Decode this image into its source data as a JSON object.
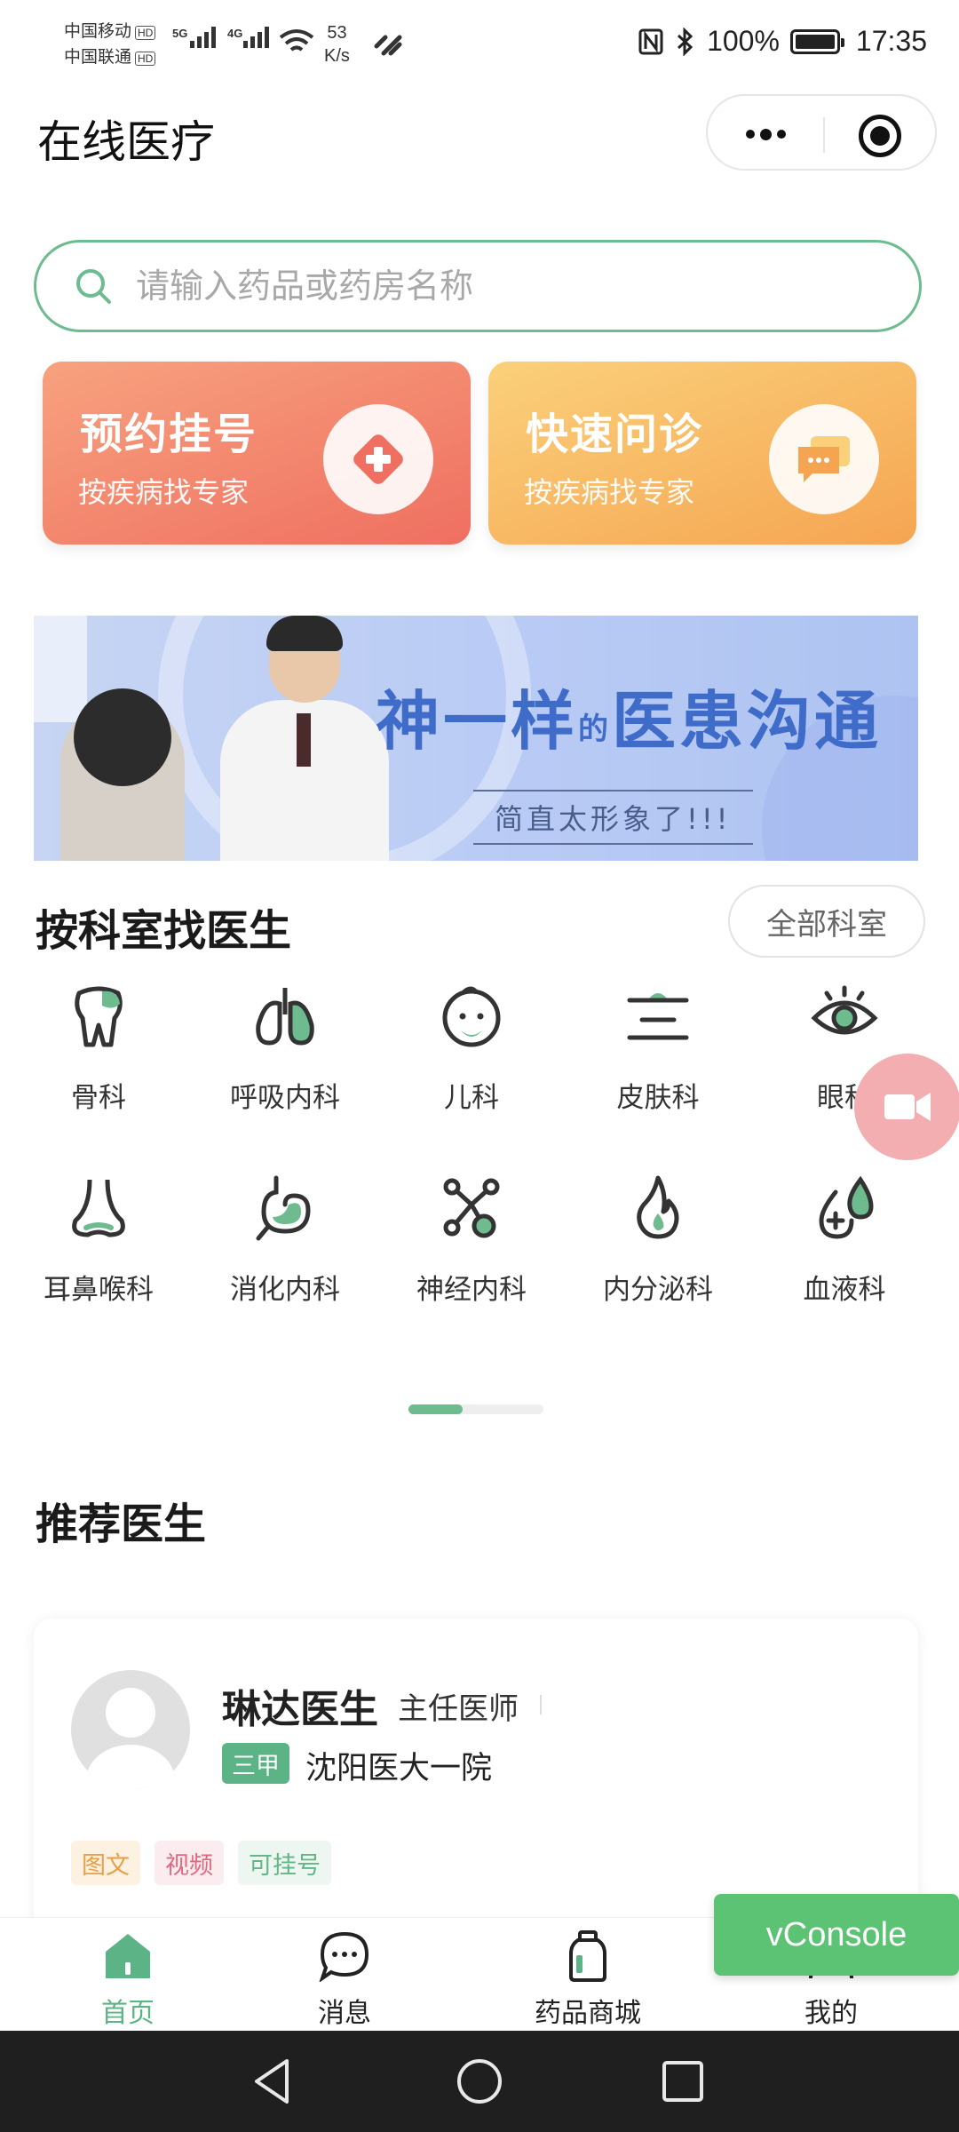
{
  "status_bar": {
    "carrier1": "中国移动",
    "carrier2": "中国联通",
    "hd": "HD",
    "net1": "5G",
    "net2": "4G",
    "speed_value": "53",
    "speed_unit": "K/s",
    "battery": "100%",
    "time": "17:35"
  },
  "header": {
    "title": "在线医疗",
    "more_icon": "ellipsis-icon",
    "close_icon": "target-icon"
  },
  "search": {
    "placeholder": "请输入药品或药房名称",
    "icon": "search-icon"
  },
  "quick_cards": [
    {
      "title": "预约挂号",
      "subtitle": "按疾病找专家",
      "icon": "medical-cross-icon"
    },
    {
      "title": "快速问诊",
      "subtitle": "按疾病找专家",
      "icon": "chat-bubble-icon"
    }
  ],
  "banner": {
    "title_a": "神一样",
    "title_small": "的",
    "title_b": "医患沟通",
    "subtitle": "简直太形象了!!!"
  },
  "departments_section": {
    "title": "按科室找医生",
    "all_button": "全部科室",
    "items": [
      {
        "label": "骨科",
        "icon": "tooth-bone-icon"
      },
      {
        "label": "呼吸内科",
        "icon": "lungs-icon"
      },
      {
        "label": "儿科",
        "icon": "baby-face-icon"
      },
      {
        "label": "皮肤科",
        "icon": "skin-layers-icon"
      },
      {
        "label": "眼科",
        "icon": "eye-icon"
      },
      {
        "label": "耳鼻喉科",
        "icon": "nose-icon"
      },
      {
        "label": "消化内科",
        "icon": "stomach-icon"
      },
      {
        "label": "神经内科",
        "icon": "neuron-icon"
      },
      {
        "label": "内分泌科",
        "icon": "flame-icon"
      },
      {
        "label": "血液科",
        "icon": "blood-drop-icon"
      }
    ],
    "page_progress": 0.4
  },
  "recommended": {
    "title": "推荐医生",
    "doctor": {
      "name": "琳达医生",
      "title": "主任医师",
      "hospital_level": "三甲",
      "hospital": "沈阳医大一院",
      "tags": [
        "图文",
        "视频",
        "可挂号"
      ]
    }
  },
  "tab_bar": {
    "tabs": [
      {
        "label": "首页",
        "icon": "home-icon",
        "active": true
      },
      {
        "label": "消息",
        "icon": "message-icon",
        "active": false
      },
      {
        "label": "药品商城",
        "icon": "medicine-bottle-icon",
        "active": false
      },
      {
        "label": "我的",
        "icon": "user-icon",
        "active": false
      }
    ]
  },
  "vconsole": {
    "label": "vConsole"
  },
  "colors": {
    "accent": "#5cb486",
    "card_red": "#ef6f60",
    "card_orange": "#f5a552",
    "float_button": "#f2aeb0",
    "vconsole": "#5cc374"
  }
}
